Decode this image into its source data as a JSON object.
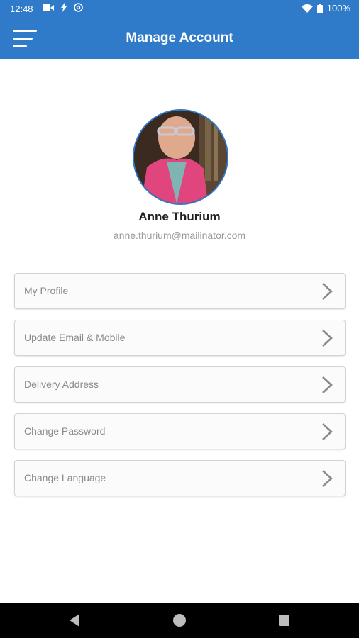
{
  "status_bar": {
    "time": "12:48",
    "battery": "100%",
    "icons_left": [
      "video-camera-icon",
      "charging-bolt-icon",
      "at-sign-icon"
    ],
    "icons_right": [
      "wifi-icon",
      "battery-icon"
    ]
  },
  "app_bar": {
    "title": "Manage Account",
    "menu_icon": "hamburger-menu-icon",
    "color": "#2f7bc9"
  },
  "profile": {
    "name": "Anne Thurium",
    "email": "anne.thurium@mailinator.com"
  },
  "menu": {
    "items": [
      {
        "label": "My Profile"
      },
      {
        "label": "Update Email & Mobile"
      },
      {
        "label": "Delivery Address"
      },
      {
        "label": "Change Password"
      },
      {
        "label": "Change Language"
      }
    ]
  },
  "nav_bar": {
    "buttons": [
      "back-icon",
      "home-icon",
      "recents-icon"
    ]
  }
}
